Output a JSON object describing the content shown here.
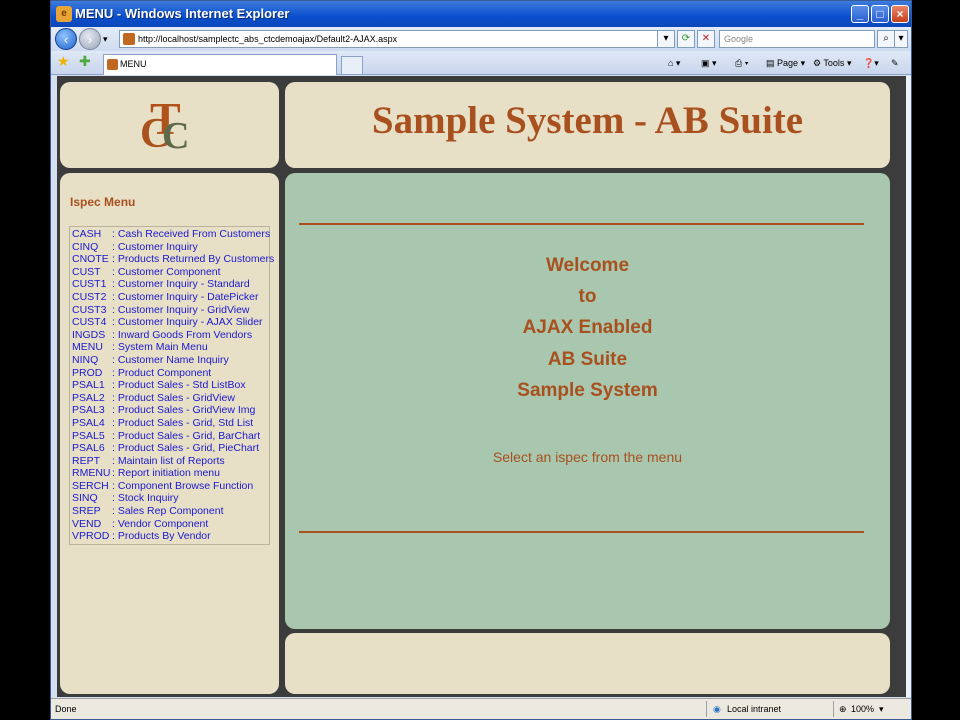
{
  "window": {
    "title": "MENU - Windows Internet Explorer",
    "url": "http://localhost/samplectc_abs_ctcdemoajax/Default2-AJAX.aspx",
    "search_placeholder": "Google",
    "tab_label": "MENU",
    "toolbar": {
      "page": "Page",
      "tools": "Tools"
    }
  },
  "logo_text": {
    "a": "T",
    "b": "C",
    "c": "C"
  },
  "header": {
    "title": "Sample System - AB Suite"
  },
  "menu": {
    "title": "Ispec Menu",
    "items": [
      {
        "code": "CASH",
        "label": ": Cash Received From Customers"
      },
      {
        "code": "CINQ",
        "label": ": Customer Inquiry"
      },
      {
        "code": "CNOTE",
        "label": ": Products Returned By Customers"
      },
      {
        "code": "CUST",
        "label": ": Customer Component"
      },
      {
        "code": "CUST1",
        "label": ": Customer Inquiry - Standard"
      },
      {
        "code": "CUST2",
        "label": ": Customer Inquiry - DatePicker"
      },
      {
        "code": "CUST3",
        "label": ": Customer Inquiry - GridView"
      },
      {
        "code": "CUST4",
        "label": ": Customer Inquiry - AJAX Slider"
      },
      {
        "code": "INGDS",
        "label": ": Inward Goods From Vendors"
      },
      {
        "code": "MENU",
        "label": ": System Main Menu"
      },
      {
        "code": "NINQ",
        "label": ": Customer Name Inquiry"
      },
      {
        "code": "PROD",
        "label": ": Product Component"
      },
      {
        "code": "PSAL1",
        "label": ": Product Sales - Std ListBox"
      },
      {
        "code": "PSAL2",
        "label": ": Product Sales - GridView"
      },
      {
        "code": "PSAL3",
        "label": ": Product Sales - GridView Img"
      },
      {
        "code": "PSAL4",
        "label": ": Product Sales - Grid, Std List"
      },
      {
        "code": "PSAL5",
        "label": ": Product Sales - Grid, BarChart"
      },
      {
        "code": "PSAL6",
        "label": ": Product Sales - Grid, PieChart"
      },
      {
        "code": "REPT",
        "label": ": Maintain list of Reports"
      },
      {
        "code": "RMENU",
        "label": ": Report initiation menu"
      },
      {
        "code": "SERCH",
        "label": ": Component Browse Function"
      },
      {
        "code": "SINQ",
        "label": ": Stock Inquiry"
      },
      {
        "code": "SREP",
        "label": ": Sales Rep Component"
      },
      {
        "code": "VEND",
        "label": ": Vendor Component"
      },
      {
        "code": "VPROD",
        "label": ": Products By Vendor"
      }
    ]
  },
  "main": {
    "welcome_lines": [
      "Welcome",
      "to",
      "AJAX Enabled",
      "AB Suite",
      "Sample System"
    ],
    "instruction": "Select an ispec from the menu"
  },
  "status": {
    "left": "Done",
    "zone": "Local intranet",
    "zoom": "100%"
  },
  "colors": {
    "accent": "#a8501e",
    "main_bg": "#a8c7ae",
    "panel_bg": "#e8dfc7",
    "link": "#1a1ad0"
  }
}
